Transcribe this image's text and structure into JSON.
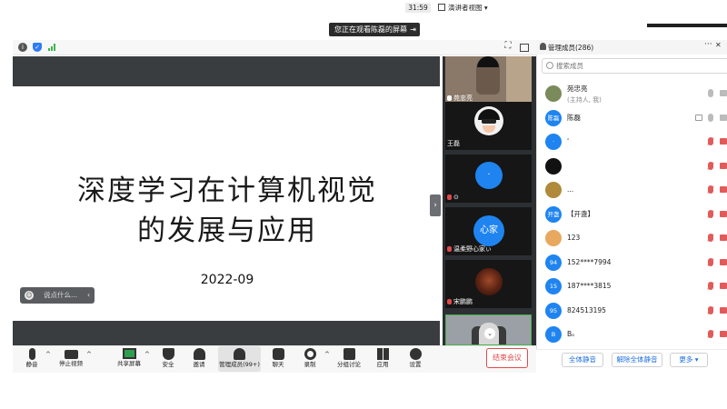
{
  "banner": {
    "text": "您正在观看陈磊的屏幕",
    "icon": "exit-icon"
  },
  "topbar": {
    "timer": "31:59",
    "view_mode": "演讲者视图",
    "icons": [
      "info-icon",
      "shield-icon",
      "signal-icon",
      "fullscreen-icon",
      "sidebar-toggle-icon"
    ]
  },
  "slide": {
    "title_line1": "深度学习在计算机视觉",
    "title_line2": "的发展与应用",
    "date": "2022-09"
  },
  "chat_pill": {
    "placeholder": "说点什么..."
  },
  "videos": [
    {
      "name": "苑忠亮",
      "muted": false
    },
    {
      "name": "王磊",
      "muted": false
    },
    {
      "name": "⊙",
      "avatar_text": "·",
      "muted": true
    },
    {
      "name": "温柔野心家ぃ",
      "avatar_text": "心家",
      "muted": true
    },
    {
      "name": "宋鹏鹏",
      "muted": true
    }
  ],
  "toolbar": {
    "mute": "静音",
    "stop_video": "停止视频",
    "share_screen": "共享屏幕",
    "security": "安全",
    "invite": "邀请",
    "members": "管理成员(99+)",
    "chat": "聊天",
    "record": "录制",
    "breakout": "分组讨论",
    "apps": "应用",
    "settings": "设置",
    "end_meeting": "结束会议"
  },
  "panel": {
    "title": "管理成员(286)",
    "search_placeholder": "搜索成员",
    "members": [
      {
        "name": "苑忠亮",
        "sub": "(主持人, 我)",
        "avatar": "",
        "color": "#7a8a5a",
        "mic_muted": false,
        "cam_muted": false
      },
      {
        "name": "陈磊",
        "sub": "",
        "avatar": "陈磊",
        "color": "#1f84f0",
        "mic_muted": false,
        "cam_muted": false,
        "sharing": true
      },
      {
        "name": "'",
        "sub": "",
        "avatar": "·",
        "color": "#1f84f0",
        "mic_muted": true,
        "cam_muted": true
      },
      {
        "name": "",
        "sub": "",
        "avatar": "",
        "color": "#111111",
        "mic_muted": true,
        "cam_muted": true
      },
      {
        "name": "...",
        "sub": "",
        "avatar": "",
        "color": "#b08a3a",
        "mic_muted": true,
        "cam_muted": true
      },
      {
        "name": "【开盏】",
        "sub": "",
        "avatar": "开盏",
        "color": "#1f84f0",
        "mic_muted": true,
        "cam_muted": true
      },
      {
        "name": "123",
        "sub": "",
        "avatar": "",
        "color": "#e8a860",
        "mic_muted": true,
        "cam_muted": true
      },
      {
        "name": "152****7994",
        "sub": "",
        "avatar": "94",
        "color": "#1f84f0",
        "mic_muted": true,
        "cam_muted": true
      },
      {
        "name": "187****3815",
        "sub": "",
        "avatar": "15",
        "color": "#1f84f0",
        "mic_muted": true,
        "cam_muted": true
      },
      {
        "name": "824513195",
        "sub": "",
        "avatar": "95",
        "color": "#1f84f0",
        "mic_muted": true,
        "cam_muted": true
      },
      {
        "name": "Bₒ",
        "sub": "",
        "avatar": "B",
        "color": "#1f84f0",
        "mic_muted": true,
        "cam_muted": true
      }
    ],
    "footer": {
      "mute_all": "全体静音",
      "unmute_all": "解除全体静音",
      "more": "更多 ▾"
    }
  },
  "colors": {
    "accent": "#1f84f0",
    "danger": "#e04a4a",
    "active_green": "#2e9e4f"
  }
}
